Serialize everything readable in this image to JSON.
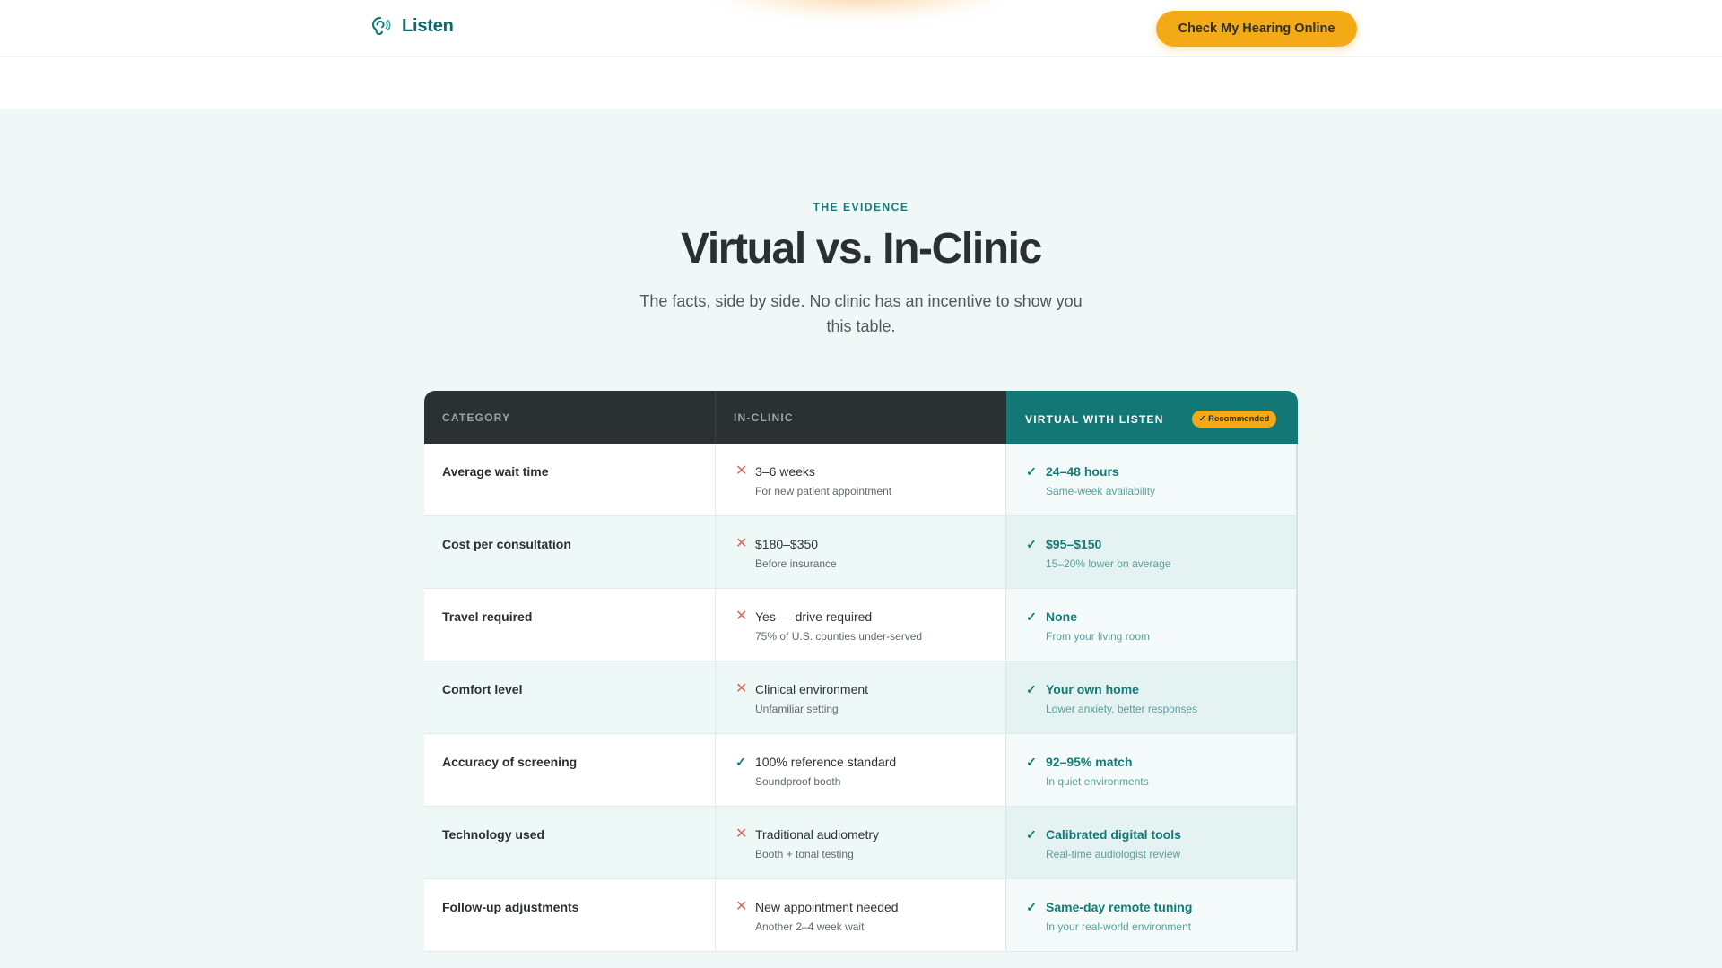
{
  "nav": {
    "brand": "Listen",
    "brand_icon": "ear-logo-icon",
    "cta": "Check My Hearing Online"
  },
  "colors": {
    "brand": "#137a78",
    "accent": "#f3aa16",
    "header_dark": "#2b3133",
    "section_bg": "#f0f8f7",
    "negative": "#e2655d"
  },
  "section": {
    "eyebrow": "THE EVIDENCE",
    "title": "Virtual vs. In-Clinic",
    "subtitle": "The facts, side by side. No clinic has an incentive to show you this table."
  },
  "table": {
    "headers": {
      "category": "CATEGORY",
      "clinic": "IN-CLINIC",
      "virtual": "VIRTUAL WITH LISTEN",
      "badge": "✓ Recommended"
    },
    "rows": [
      {
        "category": "Average wait time",
        "clinic": {
          "mark": "✕",
          "value": "3–6 weeks",
          "note": "For new patient appointment"
        },
        "virtual": {
          "mark": "✓",
          "value": "24–48 hours",
          "note": "Same-week availability"
        }
      },
      {
        "category": "Cost per consultation",
        "clinic": {
          "mark": "✕",
          "value": "$180–$350",
          "note": "Before insurance"
        },
        "virtual": {
          "mark": "✓",
          "value": "$95–$150",
          "note": "15–20% lower on average"
        }
      },
      {
        "category": "Travel required",
        "clinic": {
          "mark": "✕",
          "value": "Yes — drive required",
          "note": "75% of U.S. counties under-served"
        },
        "virtual": {
          "mark": "✓",
          "value": "None",
          "note": "From your living room"
        }
      },
      {
        "category": "Comfort level",
        "clinic": {
          "mark": "✕",
          "value": "Clinical environment",
          "note": "Unfamiliar setting"
        },
        "virtual": {
          "mark": "✓",
          "value": "Your own home",
          "note": "Lower anxiety, better responses"
        }
      },
      {
        "category": "Accuracy of screening",
        "clinic": {
          "mark": "✓",
          "value": "100% reference standard",
          "note": "Soundproof booth"
        },
        "virtual": {
          "mark": "✓",
          "value": "92–95% match",
          "note": "In quiet environments"
        }
      },
      {
        "category": "Technology used",
        "clinic": {
          "mark": "✕",
          "value": "Traditional audiometry",
          "note": "Booth + tonal testing"
        },
        "virtual": {
          "mark": "✓",
          "value": "Calibrated digital tools",
          "note": "Real-time audiologist review"
        }
      },
      {
        "category": "Follow-up adjustments",
        "clinic": {
          "mark": "✕",
          "value": "New appointment needed",
          "note": "Another 2–4 week wait"
        },
        "virtual": {
          "mark": "✓",
          "value": "Same-day remote tuning",
          "note": "In your real-world environment"
        }
      }
    ]
  }
}
